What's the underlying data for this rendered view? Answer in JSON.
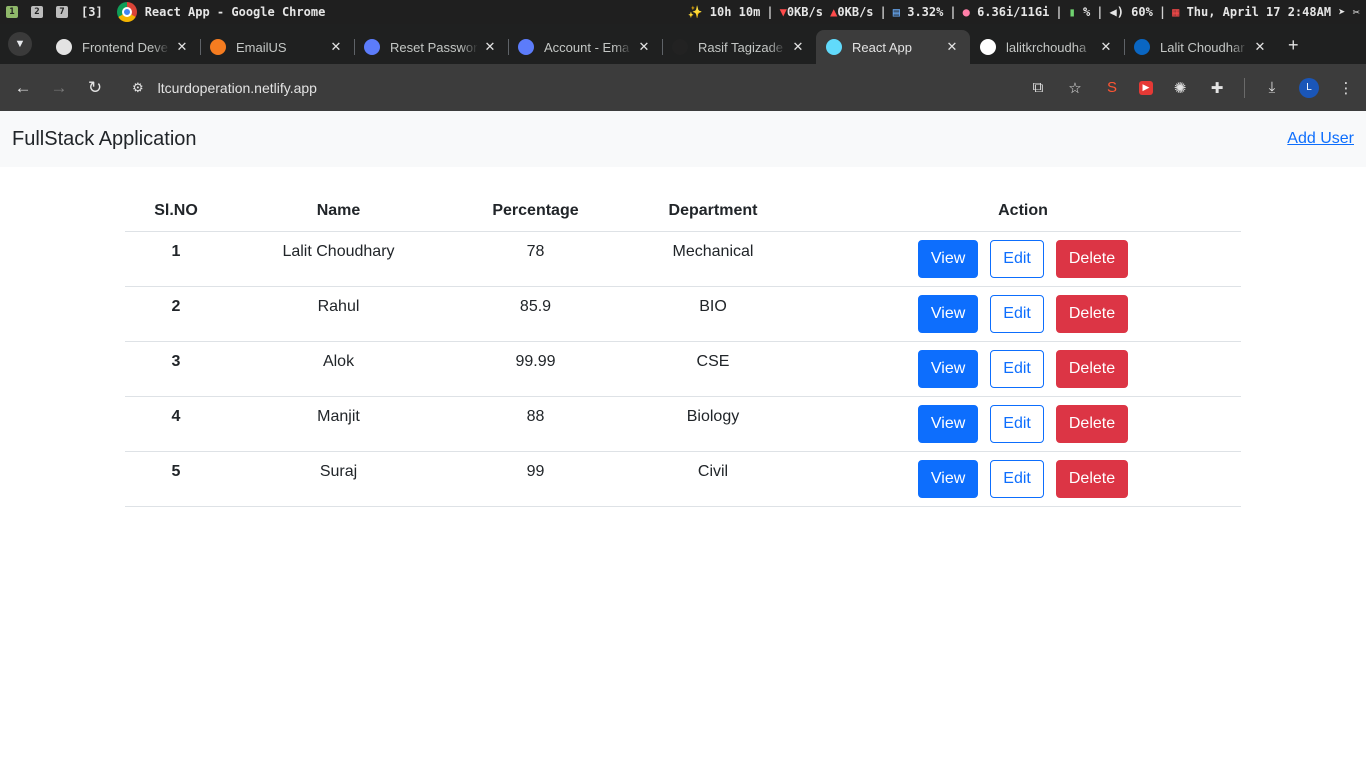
{
  "os_bar": {
    "workspaces": [
      "1",
      "2",
      "7"
    ],
    "workspace_count": "[3]",
    "window_title": "React App - Google Chrome",
    "timer": "10h 10m",
    "net_down": "0KB/s",
    "net_up": "0KB/s",
    "cpu": "3.32%",
    "mem": "6.36i/11Gi",
    "battery": "%",
    "volume": "60%",
    "datetime": "Thu, April 17 2:48AM"
  },
  "tabs": [
    {
      "title": "Frontend Deve",
      "icon": "openai-icon",
      "color": "#e3e3e3"
    },
    {
      "title": "EmailUS",
      "icon": "shield-icon",
      "color": "#f57c20"
    },
    {
      "title": "Reset Passwor",
      "icon": "bookmark-icon",
      "color": "#5c7cfa"
    },
    {
      "title": "Account - Ema",
      "icon": "bookmark-icon",
      "color": "#5c7cfa"
    },
    {
      "title": "Rasif Tagizade",
      "icon": "terminal-icon",
      "color": "#222222"
    },
    {
      "title": "React App",
      "icon": "react-icon",
      "color": "#61dafb",
      "active": true
    },
    {
      "title": "lalitkrchoudha",
      "icon": "github-icon",
      "color": "#ffffff"
    },
    {
      "title": "Lalit Choudhar",
      "icon": "linkedin-icon",
      "color": "#0a66c2"
    }
  ],
  "address_bar": {
    "url": "ltcurdoperation.netlify.app"
  },
  "app": {
    "brand": "FullStack Application",
    "add_user": "Add User"
  },
  "table": {
    "headers": [
      "Sl.NO",
      "Name",
      "Percentage",
      "Department",
      "Action"
    ],
    "rows": [
      {
        "sl": "1",
        "name": "Lalit Choudhary",
        "percentage": "78",
        "department": "Mechanical"
      },
      {
        "sl": "2",
        "name": "Rahul",
        "percentage": "85.9",
        "department": "BIO"
      },
      {
        "sl": "3",
        "name": "Alok",
        "percentage": "99.99",
        "department": "CSE"
      },
      {
        "sl": "4",
        "name": "Manjit",
        "percentage": "88",
        "department": "Biology"
      },
      {
        "sl": "5",
        "name": "Suraj",
        "percentage": "99",
        "department": "Civil"
      }
    ],
    "actions": {
      "view": "View",
      "edit": "Edit",
      "delete": "Delete"
    }
  },
  "colors": {
    "primary": "#0d6efd",
    "danger": "#dc3545",
    "navbar_bg": "#f8f9fa"
  }
}
